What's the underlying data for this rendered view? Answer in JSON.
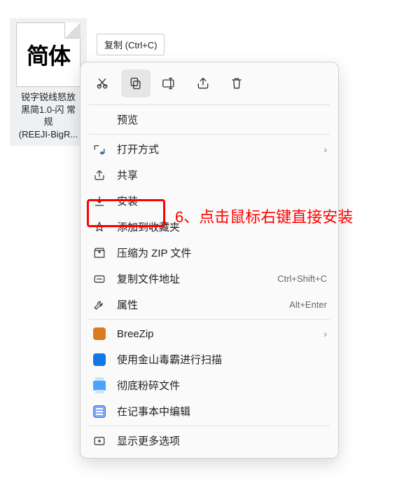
{
  "file": {
    "thumb_text": "简体",
    "name_line1": "锐字锐线怒放",
    "name_line2": "黑简1.0-闪 常",
    "name_line3": "规",
    "name_line4": "(REEJI-BigR..."
  },
  "tooltip": "复制 (Ctrl+C)",
  "toolbar": {
    "cut": "cut",
    "copy": "copy",
    "rename": "rename",
    "share": "share",
    "delete": "delete"
  },
  "menu": {
    "preview": "预览",
    "open_with": "打开方式",
    "share": "共享",
    "install": "安装",
    "add_fav": "添加到收藏夹",
    "compress_zip": "压缩为 ZIP 文件",
    "copy_path": "复制文件地址",
    "copy_path_sc": "Ctrl+Shift+C",
    "properties": "属性",
    "properties_sc": "Alt+Enter",
    "breezip": "BreeZip",
    "jinshan": "使用金山毒霸进行扫描",
    "shred": "彻底粉碎文件",
    "notepad": "在记事本中编辑",
    "more": "显示更多选项"
  },
  "annotation": "6、点击鼠标右键直接安装"
}
